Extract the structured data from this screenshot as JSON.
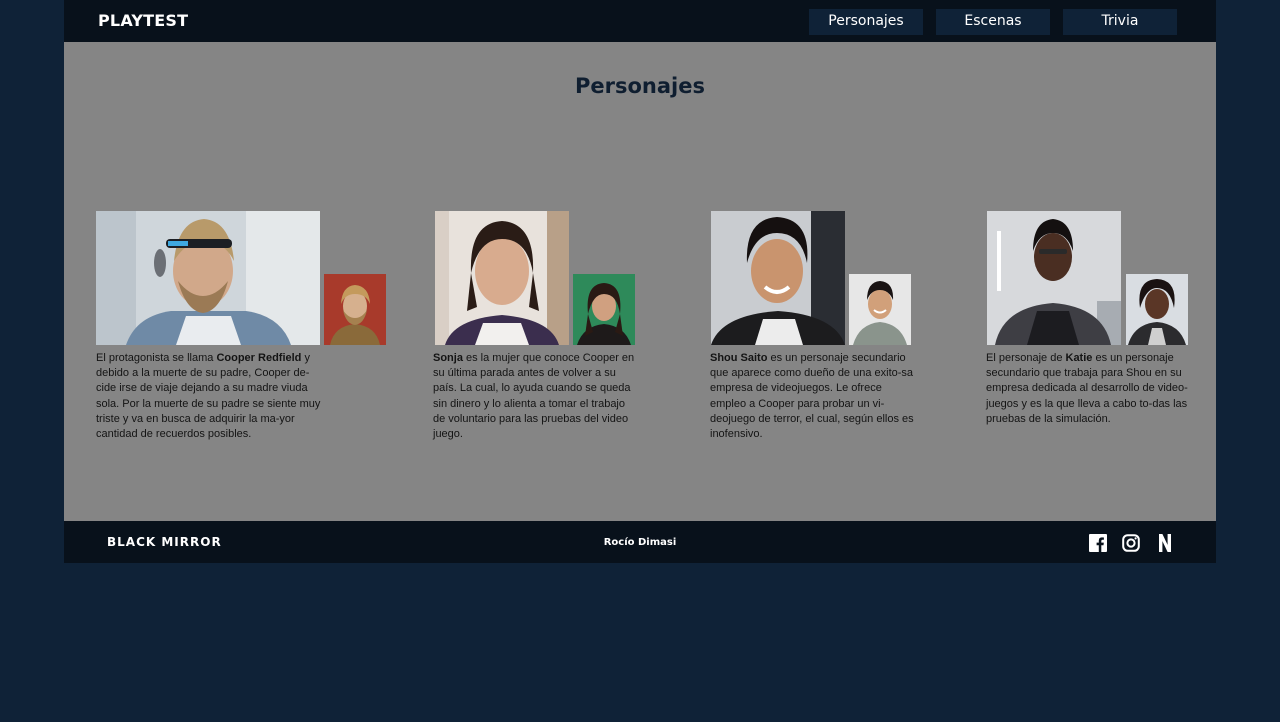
{
  "header": {
    "brand": "PLAYTEST",
    "nav": [
      "Personajes",
      "Escenas",
      "Trivia"
    ]
  },
  "main": {
    "title": "Personajes",
    "characters": [
      {
        "name": "Cooper Redfield",
        "pre": "El protagonista se llama ",
        "post": " y debido a la muerte de su padre, Cooper de-cide irse de viaje dejando a su madre viuda sola. Por la muerte de su padre se siente muy triste y va en busca de adquirir la ma-yor cantidad de recuerdos posibles."
      },
      {
        "name": "Sonja",
        "pre": "",
        "post": " es la mujer que conoce Cooper en su última parada antes de volver a su país. La cual, lo ayuda cuando se queda sin dinero y lo alienta a tomar el trabajo de voluntario para las pruebas del video juego."
      },
      {
        "name": "Shou Saito",
        "pre": "",
        "post": " es un personaje secundario que aparece como dueño de una exito-sa empresa de videojuegos. Le ofrece empleo a Cooper para probar un vi-deojuego de terror, el cual, según ellos es inofensivo."
      },
      {
        "name": "Katie",
        "pre": "El personaje de ",
        "post": " es un personaje secundario que trabaja para Shou en su empresa dedicada al desarrollo de video-juegos y es la que lleva a cabo to-das las pruebas de la simulación."
      }
    ]
  },
  "footer": {
    "logo": "BLACK MIRROR",
    "author": "Rocío Dimasi",
    "social": [
      "facebook-icon",
      "instagram-icon",
      "netflix-icon"
    ]
  },
  "colors": {
    "background": "#0f2237",
    "bar": "#08111b",
    "main": "#858585",
    "nav_button": "#0f2237"
  }
}
